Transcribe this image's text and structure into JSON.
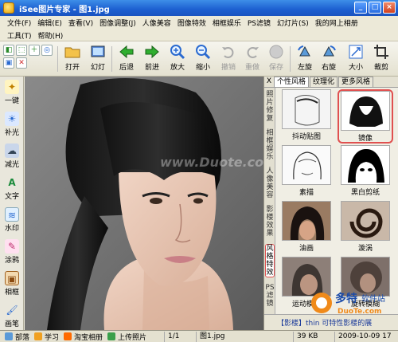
{
  "window": {
    "title": "iSee图片专家 - 图1.jpg",
    "controls": [
      "_",
      "□",
      "×"
    ]
  },
  "menu": {
    "row1": [
      "文件(F)",
      "编辑(E)",
      "查看(V)",
      "图像调整(J)",
      "人像美容",
      "图像特效",
      "相框娱乐",
      "PS滤镜",
      "幻灯片(S)",
      "我的网上相册"
    ],
    "row2": [
      "工具(T)",
      "帮助(H)"
    ]
  },
  "toolbar": {
    "small_tools": [
      "◧",
      "⬚",
      "＋",
      "◎",
      "▣",
      "✕"
    ],
    "buttons": [
      {
        "label": "打开",
        "icon": "folder-icon"
      },
      {
        "label": "幻灯",
        "icon": "slideshow-icon"
      },
      {
        "label": "后退",
        "icon": "arrow-left-icon"
      },
      {
        "label": "前进",
        "icon": "arrow-right-icon"
      },
      {
        "label": "放大",
        "icon": "zoom-in-icon"
      },
      {
        "label": "缩小",
        "icon": "zoom-out-icon"
      },
      {
        "label": "撤销",
        "icon": "undo-icon",
        "disabled": true
      },
      {
        "label": "重做",
        "icon": "redo-icon",
        "disabled": true
      },
      {
        "label": "保存",
        "icon": "save-icon",
        "disabled": true
      },
      {
        "label": "左旋",
        "icon": "rotate-left-icon"
      },
      {
        "label": "右旋",
        "icon": "rotate-right-icon"
      },
      {
        "label": "大小",
        "icon": "resize-icon"
      },
      {
        "label": "裁剪",
        "icon": "crop-icon"
      }
    ]
  },
  "left_tools": [
    {
      "label": "一键",
      "icon": "magic-wand-icon"
    },
    {
      "label": "补光",
      "icon": "fill-light-icon"
    },
    {
      "label": "减光",
      "icon": "reduce-light-icon"
    },
    {
      "label": "文字",
      "icon": "text-icon"
    },
    {
      "label": "水印",
      "icon": "watermark-icon"
    },
    {
      "label": "涂鸦",
      "icon": "doodle-icon"
    },
    {
      "label": "相框",
      "icon": "frame-icon"
    },
    {
      "label": "画笔",
      "icon": "brush-icon"
    }
  ],
  "photo": {
    "watermark": "www.Duote.com"
  },
  "right_panel": {
    "close": "X",
    "tabs": [
      "个性风格",
      "纹理化",
      "更多风格"
    ],
    "vertical_tabs": [
      "照片修复",
      "相框娱乐",
      "人像美容",
      "影楼效果",
      "风格特效",
      "PS滤镜"
    ],
    "active_vertical_tab": "风格特效",
    "effects": [
      {
        "label": "抖动贴图"
      },
      {
        "label": "镜像"
      },
      {
        "label": "素描"
      },
      {
        "label": "黑白剪纸",
        "selected": true
      },
      {
        "label": "油画"
      },
      {
        "label": "漩涡"
      },
      {
        "label": "运动模糊"
      },
      {
        "label": "旋转模糊"
      }
    ],
    "footer": "【影楼】thin 可特性影楼的展"
  },
  "status": {
    "items": [
      {
        "label": "部落",
        "icon": "tribe-icon"
      },
      {
        "label": "学习",
        "icon": "study-icon"
      },
      {
        "label": "淘宝相册",
        "icon": "taobao-icon"
      },
      {
        "label": "上传照片",
        "icon": "upload-icon"
      }
    ],
    "page": "1/1",
    "file": "图1.jpg",
    "size": "39 KB",
    "date": "2009-10-09 17"
  },
  "logo": {
    "text1": "多特",
    "text2": "软件站",
    "url": "DuoTe.com"
  },
  "colors": {
    "title_bar": "#1c5fd0",
    "selection": "#e05050",
    "photo_bg": "#6f6f6f"
  }
}
